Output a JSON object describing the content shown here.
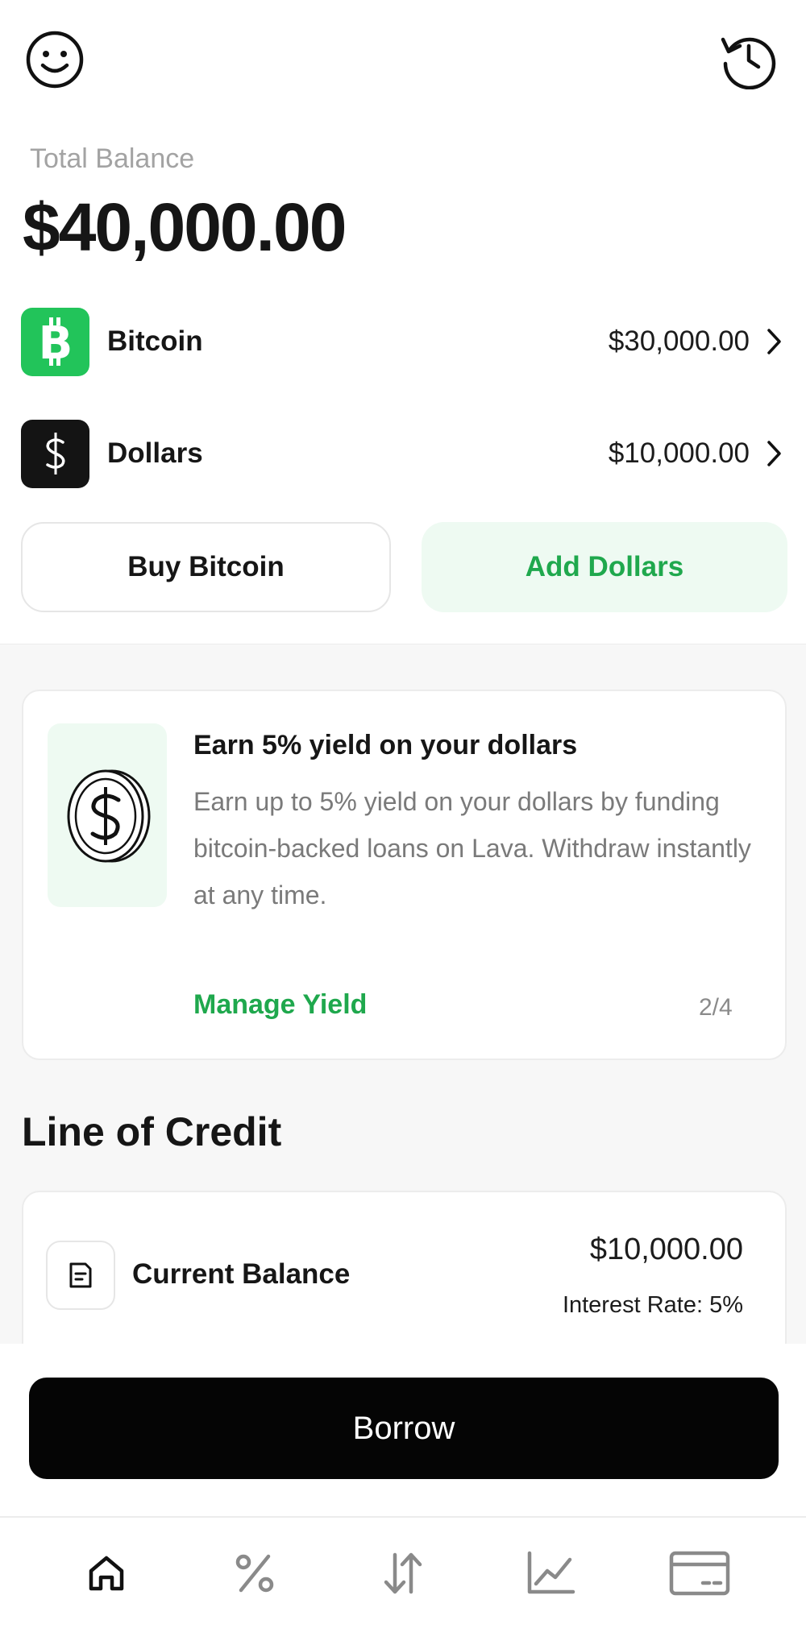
{
  "header": {
    "left_icon": "smile-icon",
    "right_icon": "history-icon"
  },
  "balance": {
    "label": "Total Balance",
    "value": "$40,000.00"
  },
  "assets": [
    {
      "name": "Bitcoin",
      "value": "$30,000.00",
      "icon": "bitcoin-icon",
      "tile_color": "#22c45a"
    },
    {
      "name": "Dollars",
      "value": "$10,000.00",
      "icon": "dollar-icon",
      "tile_color": "#141414"
    }
  ],
  "actions": {
    "buy_label": "Buy Bitcoin",
    "add_label": "Add Dollars"
  },
  "promo": {
    "title": "Earn 5% yield on your dollars",
    "body": "Earn up to 5% yield on your dollars by funding bitcoin-backed loans on Lava. Withdraw instantly at any time.",
    "link": "Manage Yield",
    "page": "2/4",
    "icon": "dollar-coin-icon"
  },
  "credit": {
    "section_title": "Line of Credit",
    "label": "Current Balance",
    "amount": "$10,000.00",
    "rate": "Interest Rate: 5%",
    "icon": "document-icon"
  },
  "borrow_label": "Borrow",
  "tabs": [
    {
      "name": "home",
      "icon": "home-icon"
    },
    {
      "name": "yield",
      "icon": "percent-icon"
    },
    {
      "name": "transfer",
      "icon": "transfer-arrows-icon"
    },
    {
      "name": "markets",
      "icon": "chart-icon"
    },
    {
      "name": "card",
      "icon": "card-icon"
    }
  ],
  "colors": {
    "accent_green": "#1fa84d",
    "bitcoin_green": "#22c45a",
    "soft_green": "#eefaf2",
    "black": "#050505"
  }
}
